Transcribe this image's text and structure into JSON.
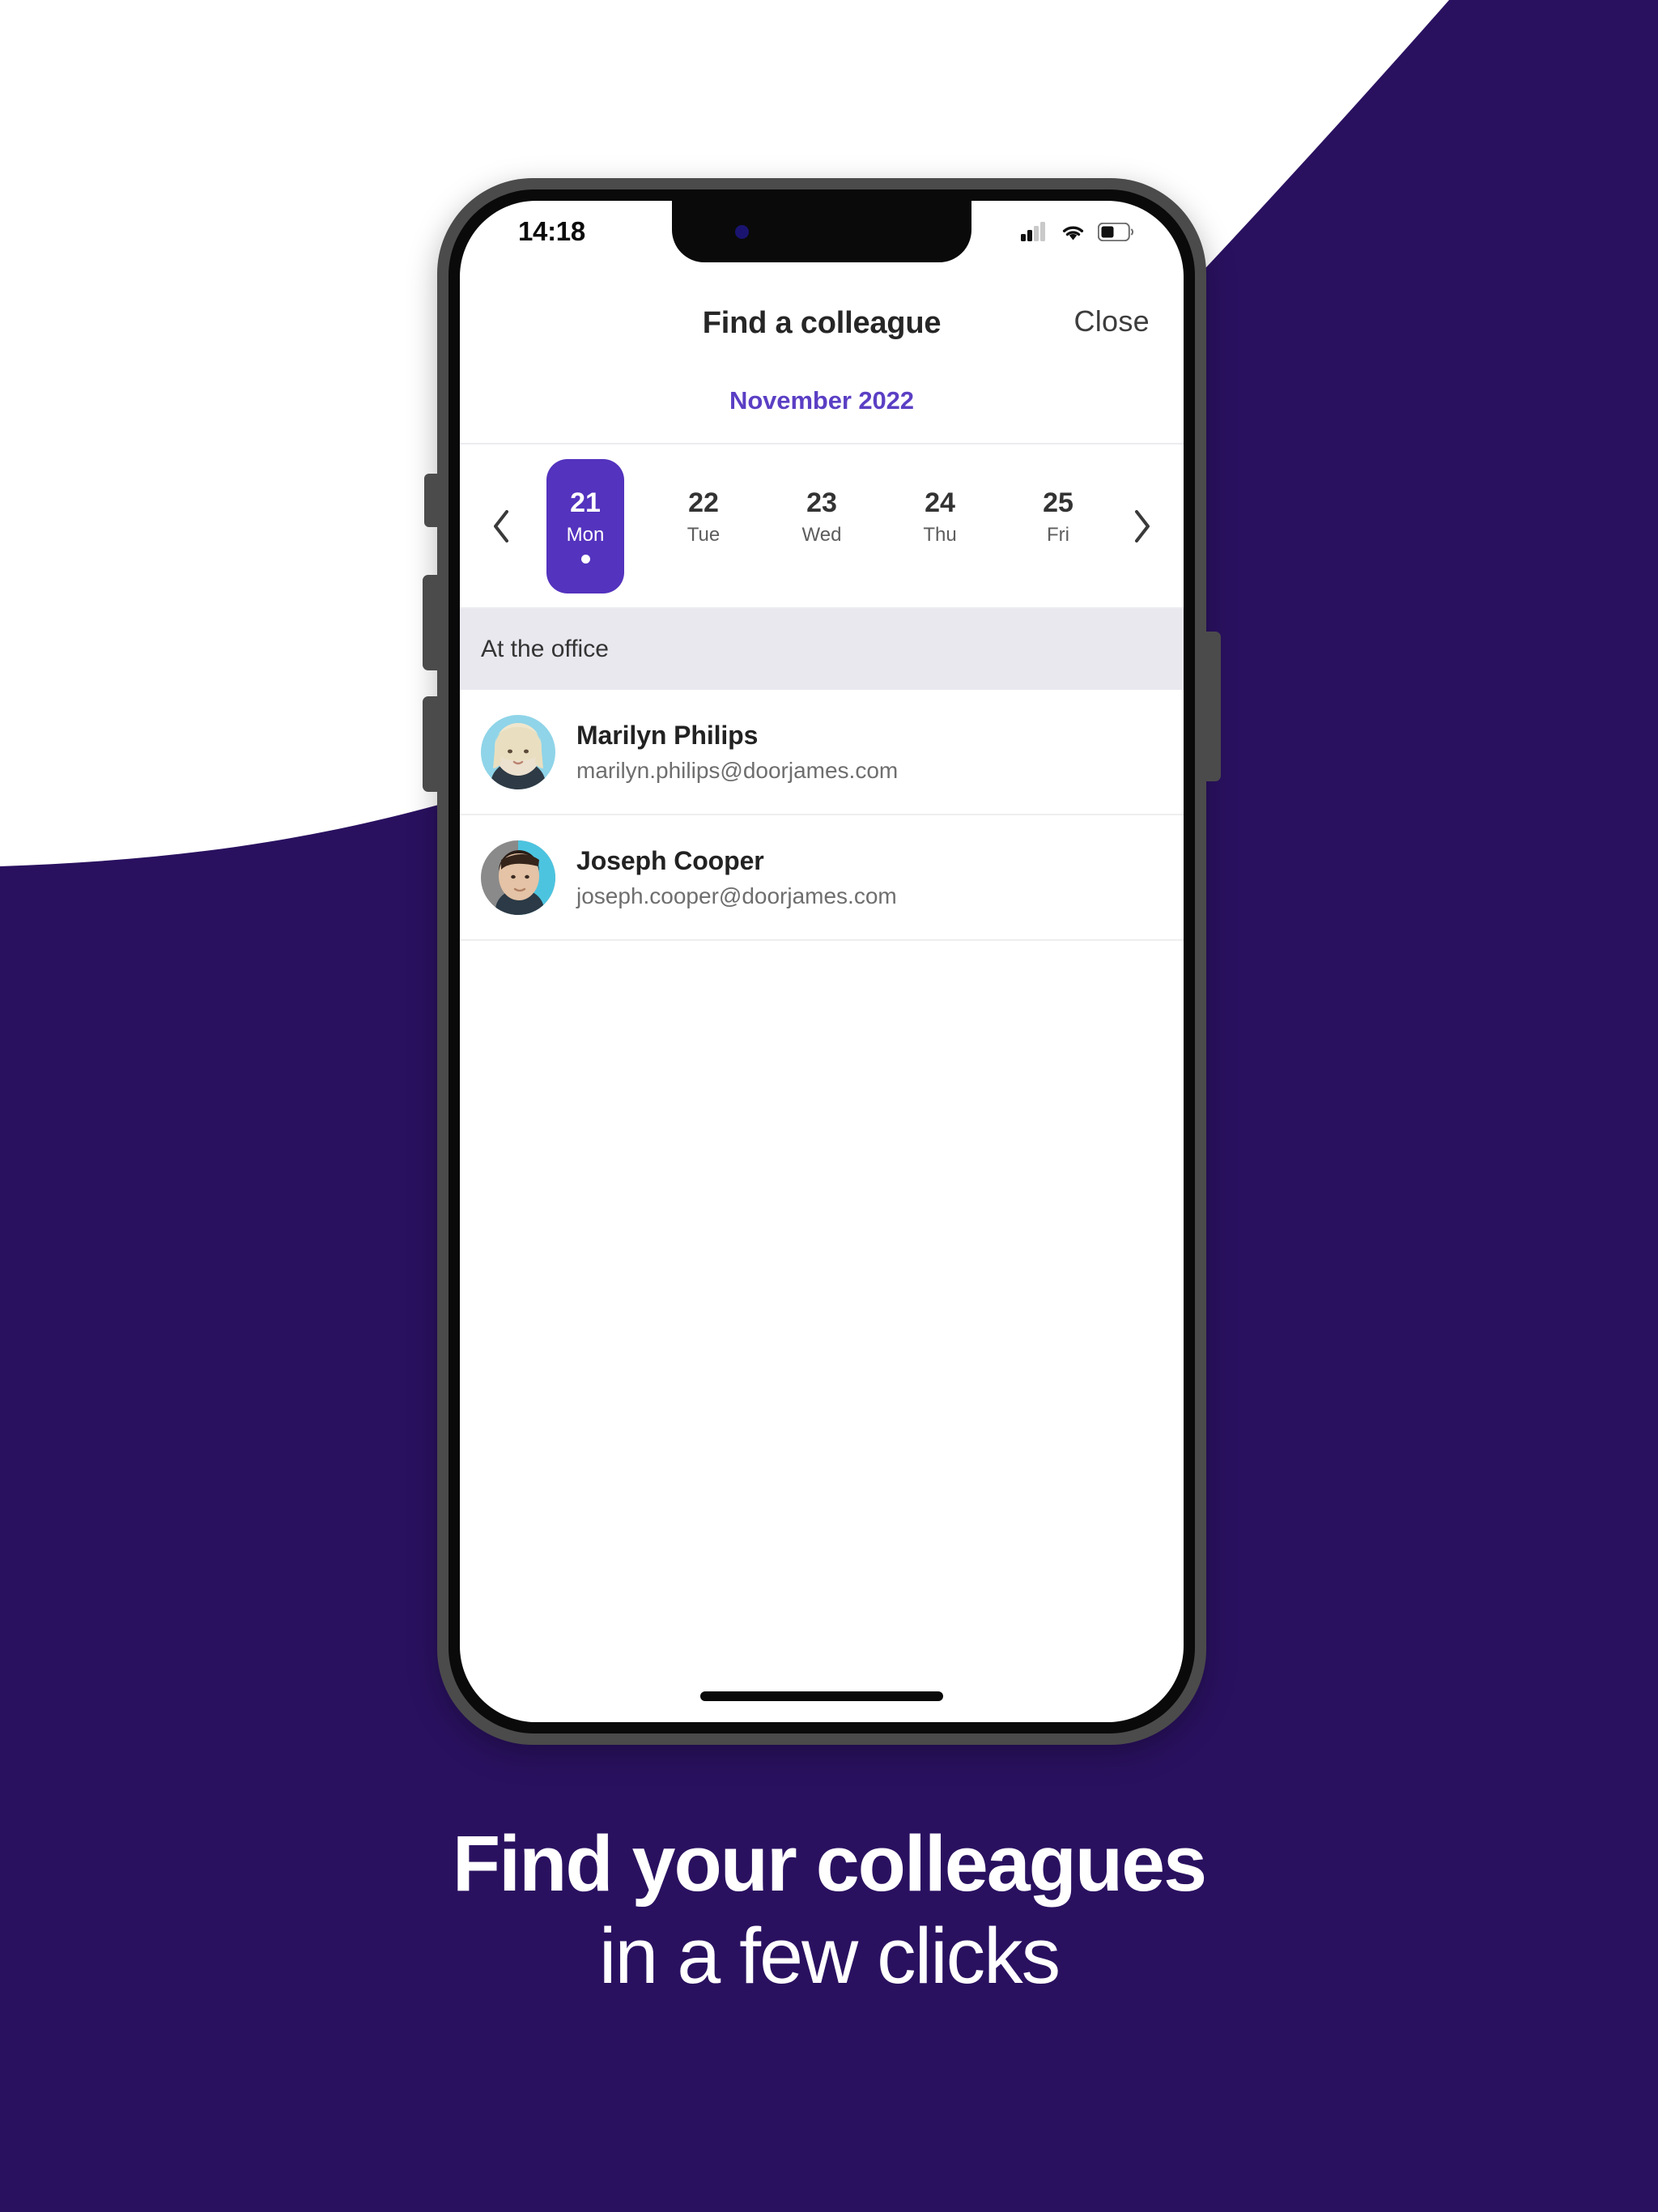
{
  "colors": {
    "brand_dark": "#2A1160",
    "accent_purple": "#5B3FC4",
    "selected_day": "#5433BE",
    "section_bg": "#E9E8EF"
  },
  "status_bar": {
    "time": "14:18",
    "signal_icon": "cellular-signal-icon",
    "wifi_icon": "wifi-icon",
    "battery_icon": "battery-icon"
  },
  "app": {
    "title": "Find a colleague",
    "close_label": "Close",
    "month_label": "November 2022",
    "prev_icon": "chevron-left-icon",
    "next_icon": "chevron-right-icon",
    "days": [
      {
        "num": "21",
        "name": "Mon",
        "selected": true,
        "has_dot": true
      },
      {
        "num": "22",
        "name": "Tue",
        "selected": false,
        "has_dot": false
      },
      {
        "num": "23",
        "name": "Wed",
        "selected": false,
        "has_dot": false
      },
      {
        "num": "24",
        "name": "Thu",
        "selected": false,
        "has_dot": false
      },
      {
        "num": "25",
        "name": "Fri",
        "selected": false,
        "has_dot": false
      }
    ],
    "section_label": "At the office",
    "colleagues": [
      {
        "name": "Marilyn Philips",
        "email": "marilyn.philips@doorjames.com",
        "avatar": "avatar-woman-blonde"
      },
      {
        "name": "Joseph Cooper",
        "email": "joseph.cooper@doorjames.com",
        "avatar": "avatar-man-dark-hair"
      }
    ]
  },
  "headline": {
    "line1": "Find your colleagues",
    "line2": "in a few clicks"
  }
}
